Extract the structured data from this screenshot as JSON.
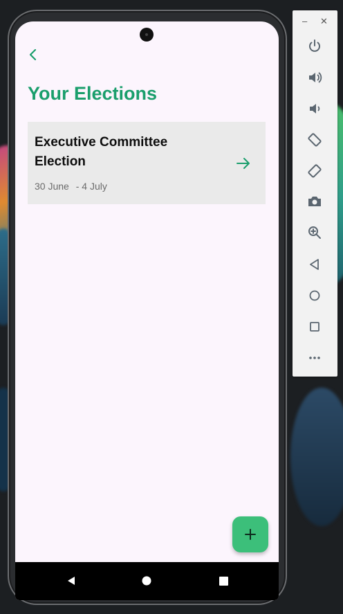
{
  "app": {
    "title": "Your Elections"
  },
  "elections": [
    {
      "name": "Executive Committee Election",
      "start": "30 June",
      "end": "- 4 July"
    }
  ],
  "colors": {
    "accent": "#1a9e6c",
    "fab": "#3cbf7a",
    "card_bg": "#eaeaea",
    "screen_bg": "#fcf5fd"
  },
  "icons": {
    "back": "chevron-left-icon",
    "card_action": "arrow-right-icon",
    "fab": "plus-icon"
  },
  "emulator_toolbar": {
    "window": [
      "minimize-icon",
      "close-icon"
    ],
    "tools": [
      "power-icon",
      "volume-up-icon",
      "volume-down-icon",
      "rotate-left-icon",
      "rotate-right-icon",
      "camera-icon",
      "zoom-icon",
      "back-icon",
      "home-icon",
      "overview-icon",
      "more-icon"
    ]
  }
}
